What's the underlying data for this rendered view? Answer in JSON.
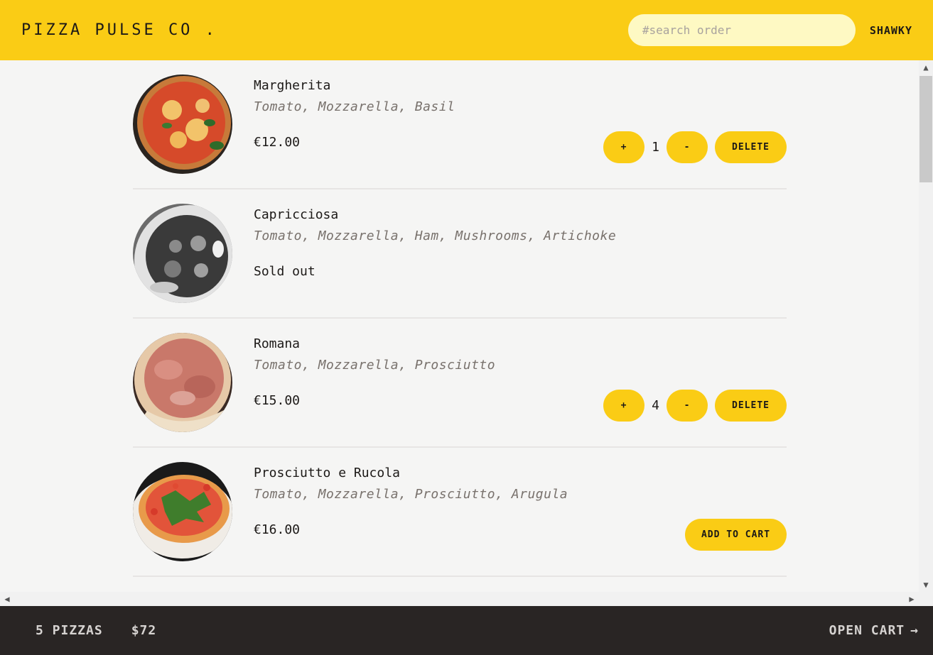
{
  "header": {
    "brand": "PIZZA PULSE CO .",
    "search_placeholder": "#search order",
    "user": "SHAWKY"
  },
  "menu": [
    {
      "name": "Margherita",
      "ingredients": "Tomato, Mozzarella, Basil",
      "price": "€12.00",
      "quantity": "1",
      "plus": "+",
      "minus": "-",
      "delete": "DELETE"
    },
    {
      "name": "Capricciosa",
      "ingredients": "Tomato, Mozzarella, Ham, Mushrooms, Artichoke",
      "status": "Sold out"
    },
    {
      "name": "Romana",
      "ingredients": "Tomato, Mozzarella, Prosciutto",
      "price": "€15.00",
      "quantity": "4",
      "plus": "+",
      "minus": "-",
      "delete": "DELETE"
    },
    {
      "name": "Prosciutto e Rucola",
      "ingredients": "Tomato, Mozzarella, Prosciutto, Arugula",
      "price": "€16.00",
      "add": "ADD TO CART"
    }
  ],
  "footer": {
    "pizzas": "5 PIZZAS",
    "total": "$72",
    "open_cart": "OPEN CART",
    "arrow": "→"
  },
  "icons": {
    "scroll_up": "▲",
    "scroll_down": "▼",
    "scroll_left": "◀",
    "scroll_right": "▶"
  }
}
